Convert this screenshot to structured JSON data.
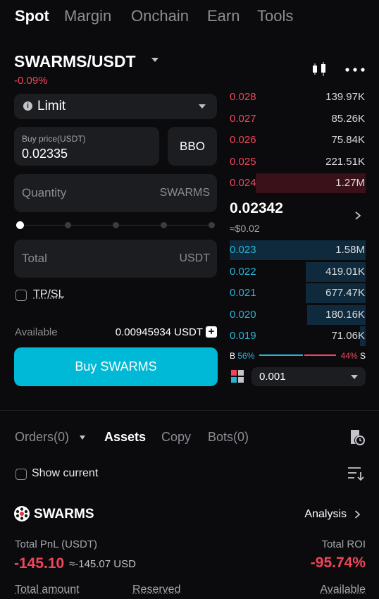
{
  "top_tabs": [
    "Spot",
    "Margin",
    "Onchain",
    "Earn",
    "Tools"
  ],
  "pair": {
    "title": "SWARMS/USDT",
    "change": "-0.09%"
  },
  "order_form": {
    "order_type": "Limit",
    "buy_price_caption": "Buy price(USDT)",
    "buy_price_value": "0.02335",
    "bbo_label": "BBO",
    "quantity_placeholder": "Quantity",
    "quantity_unit": "SWARMS",
    "slider_level_pct": 0,
    "total_placeholder": "Total",
    "total_unit": "USDT",
    "tpsl_label": "TP/SL",
    "available_label": "Available",
    "available_value": "0.00945934 USDT",
    "buy_button": "Buy SWARMS"
  },
  "order_book": {
    "asks": [
      {
        "price": "0.028",
        "qty": "139.97K",
        "depth_pct": 0
      },
      {
        "price": "0.027",
        "qty": "85.26K",
        "depth_pct": 0
      },
      {
        "price": "0.026",
        "qty": "75.84K",
        "depth_pct": 0
      },
      {
        "price": "0.025",
        "qty": "221.51K",
        "depth_pct": 0
      },
      {
        "price": "0.024",
        "qty": "1.27M",
        "depth_pct": 81
      }
    ],
    "last_price": "0.02342",
    "last_price_usd": "≈$0.02",
    "bids": [
      {
        "price": "0.023",
        "qty": "1.58M",
        "depth_pct": 100
      },
      {
        "price": "0.022",
        "qty": "419.01K",
        "depth_pct": 44
      },
      {
        "price": "0.021",
        "qty": "677.47K",
        "depth_pct": 44
      },
      {
        "price": "0.020",
        "qty": "180.16K",
        "depth_pct": 43
      },
      {
        "price": "0.019",
        "qty": "71.06K",
        "depth_pct": 4
      }
    ],
    "ratio_b_letter": "B",
    "ratio_b_pct": "56%",
    "ratio_s_pct": "44%",
    "ratio_s_letter": "S",
    "depth_step": "0.001"
  },
  "bottom_tabs": [
    "Orders(0)",
    "Assets",
    "Copy",
    "Bots(0)"
  ],
  "show_current_label": "Show current",
  "asset": {
    "name": "SWARMS",
    "analysis_label": "Analysis",
    "pnl_label": "Total PnL (USDT)",
    "pnl_value": "-145.10",
    "pnl_usd": "≈-145.07 USD",
    "roi_label": "Total ROI",
    "roi_value": "-95.74%",
    "footer_labels": [
      "Total amount",
      "Reserved",
      "Available"
    ]
  },
  "colors": {
    "accent": "#00b9d6",
    "sell": "#f0465a",
    "buy": "#27b3d3",
    "background": "#0b0b0d",
    "panel": "#1c1d21"
  },
  "icons": [
    "info-icon",
    "chevron-down-icon",
    "candlestick-chart-icon",
    "more-icon",
    "chevron-right-icon",
    "plus-icon",
    "orderbook-layout-icon",
    "order-history-icon",
    "sort-icon",
    "swarms-coin-icon"
  ]
}
